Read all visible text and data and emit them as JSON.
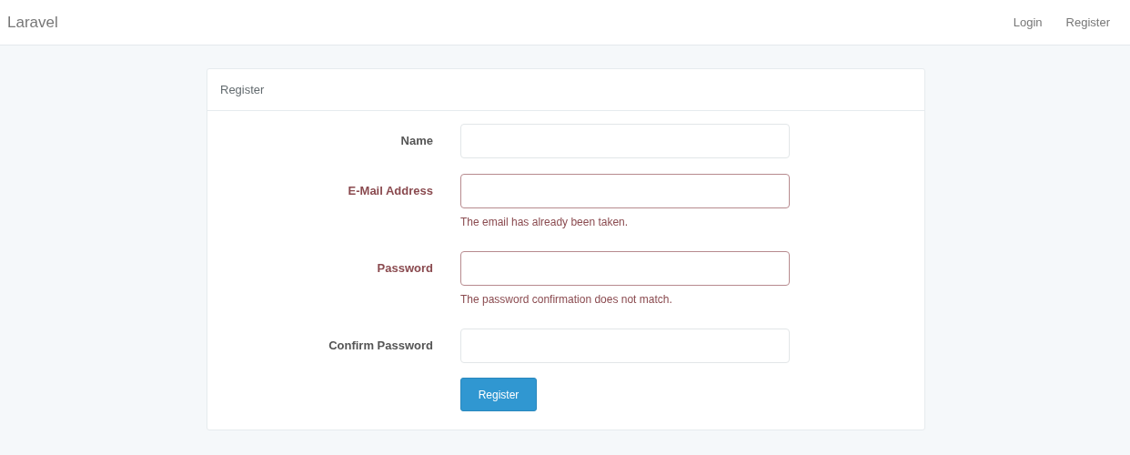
{
  "navbar": {
    "brand": "Laravel",
    "links": [
      "Login",
      "Register"
    ]
  },
  "panel": {
    "heading": "Register",
    "fields": [
      {
        "label": "Name",
        "invalid": false
      },
      {
        "label": "E-Mail Address",
        "invalid": true,
        "error": "The email has already been taken."
      },
      {
        "label": "Password",
        "invalid": true,
        "error": "The password confirmation does not match."
      },
      {
        "label": "Confirm Password",
        "invalid": false
      }
    ],
    "submit": "Register"
  }
}
